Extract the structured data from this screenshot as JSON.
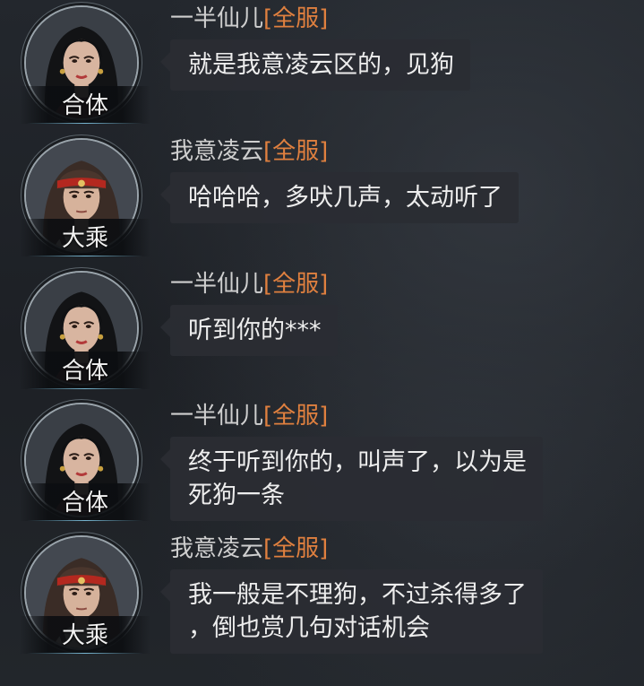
{
  "messages": [
    {
      "sender": "一半仙儿",
      "server_tag": "[全服]",
      "rank": "合体",
      "avatar": "female-cultivator-portrait",
      "text": "就是我意凌云区的，见狗"
    },
    {
      "sender": "我意凌云",
      "server_tag": "[全服]",
      "rank": "大乘",
      "avatar": "male-cultivator-red-headband-portrait",
      "text": "哈哈哈，多吠几声，太动听了"
    },
    {
      "sender": "一半仙儿",
      "server_tag": "[全服]",
      "rank": "合体",
      "avatar": "female-cultivator-portrait",
      "text": "听到你的***"
    },
    {
      "sender": "一半仙儿",
      "server_tag": "[全服]",
      "rank": "合体",
      "avatar": "female-cultivator-portrait",
      "text": "终于听到你的，叫声了，以为是\n死狗一条"
    },
    {
      "sender": "我意凌云",
      "server_tag": "[全服]",
      "rank": "大乘",
      "avatar": "male-cultivator-red-headband-portrait",
      "text": "我一般是不理狗，不过杀得多了\n，倒也赏几句对话机会"
    }
  ],
  "colors": {
    "server_tag": "#e0803f",
    "sender_name": "#cfcfcf",
    "message_text": "#ededed",
    "bubble_bg": "#2a2d33",
    "rank_text": "#f2f2f2"
  }
}
